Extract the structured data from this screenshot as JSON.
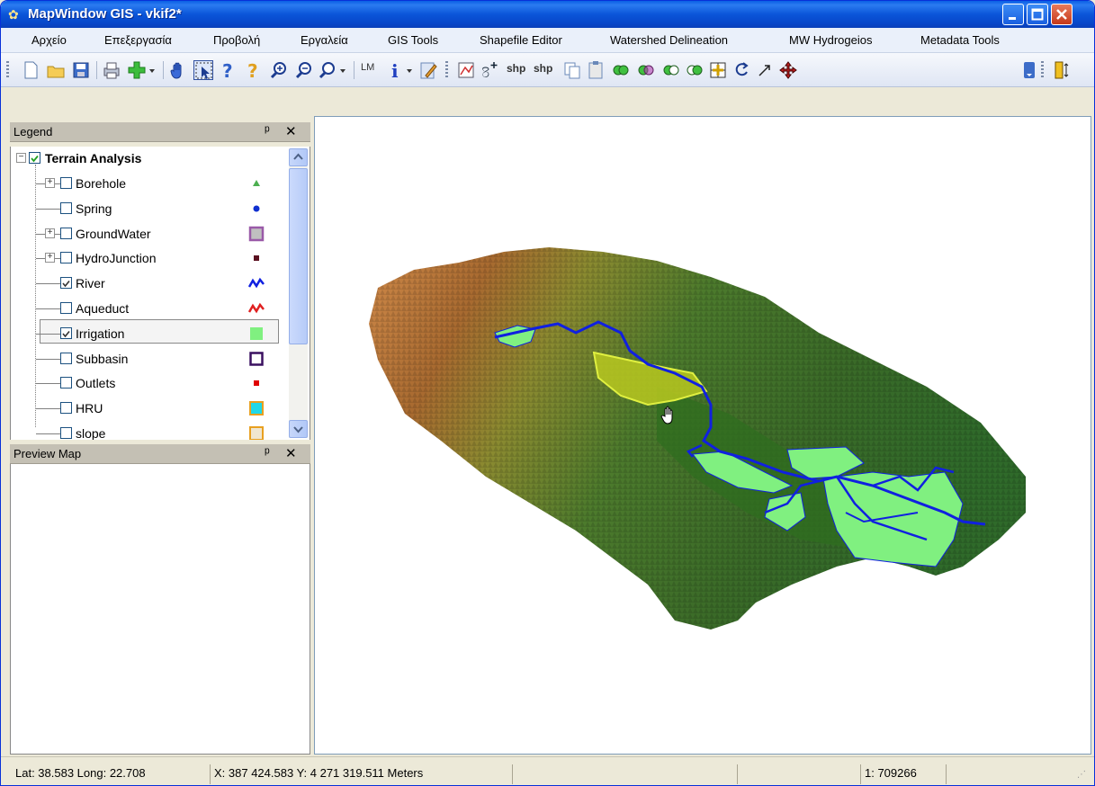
{
  "window": {
    "title": "MapWindow GIS  - vkif2*"
  },
  "menu": [
    "Αρχείο",
    "Επεξεργασία",
    "Προβολή",
    "Εργαλεία",
    "GIS Tools",
    "Shapefile Editor",
    "Watershed Delineation",
    "MW Hydrogeios",
    "Metadata Tools"
  ],
  "toolbar": {
    "lm_label": "LM",
    "shp1": "shp",
    "shp2": "shp"
  },
  "legend": {
    "title": "Legend",
    "group": "Terrain Analysis",
    "layers": [
      {
        "name": "Borehole",
        "checked": false,
        "expandable": true,
        "symbol": "triangle",
        "color": "#4caf50"
      },
      {
        "name": "Spring",
        "checked": false,
        "expandable": false,
        "symbol": "dot",
        "color": "#1030d0"
      },
      {
        "name": "GroundWater",
        "checked": false,
        "expandable": true,
        "symbol": "square-outline",
        "color": "#9a5aa8"
      },
      {
        "name": "HydroJunction",
        "checked": false,
        "expandable": true,
        "symbol": "small-square",
        "color": "#5a1020"
      },
      {
        "name": "River",
        "checked": true,
        "expandable": false,
        "symbol": "wave",
        "color": "#1020e0"
      },
      {
        "name": "Aqueduct",
        "checked": false,
        "expandable": false,
        "symbol": "wave",
        "color": "#e02020"
      },
      {
        "name": "Irrigation",
        "checked": true,
        "expandable": false,
        "symbol": "fill",
        "color": "#80f080"
      },
      {
        "name": "Subbasin",
        "checked": false,
        "expandable": false,
        "symbol": "square-outline-thick",
        "color": "#3a1060"
      },
      {
        "name": "Outlets",
        "checked": false,
        "expandable": false,
        "symbol": "small-square",
        "color": "#e00000"
      },
      {
        "name": "HRU",
        "checked": false,
        "expandable": false,
        "symbol": "fill-border",
        "color": "#20d8e8"
      },
      {
        "name": "slope",
        "checked": false,
        "expandable": false,
        "symbol": "fill-border",
        "color": "#f0e6d0"
      }
    ]
  },
  "preview": {
    "title": "Preview Map"
  },
  "status": {
    "latlong": "Lat: 38.583 Long: 22.708",
    "xy": "X: 387 424.583 Y: 4 271 319.511 Meters",
    "scale": "1: 709266"
  },
  "colors": {
    "titlebar": "#0a55d9",
    "river": "#1020e0",
    "irrigation": "#80f080",
    "selected_irrigation": "#b8c820"
  }
}
